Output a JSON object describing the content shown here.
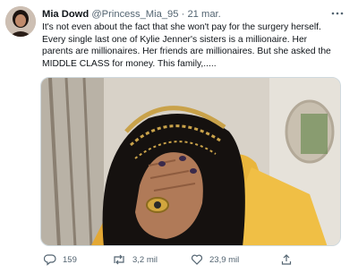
{
  "author": {
    "name": "Mia Dowd",
    "handle": "@Princess_Mia_95",
    "separator": "·",
    "date": "21 mar."
  },
  "tweet": {
    "text": "It's not even about the fact that she won't pay for the surgery herself. Every single last one of Kylie Jenner's sisters is a millionaire. Her parents are millionaires. Her friends are millionaires. But she asked the MIDDLE CLASS for money. This family,....."
  },
  "actions": {
    "reply_count": "159",
    "retweet_count": "3,2 mil",
    "like_count": "23,9 mil"
  },
  "icons": {
    "more": "more-icon",
    "reply": "reply-icon",
    "retweet": "retweet-icon",
    "like": "heart-icon",
    "share": "share-icon"
  },
  "colors": {
    "text": "#0f1419",
    "secondary": "#536471",
    "border": "#cfd9de"
  }
}
